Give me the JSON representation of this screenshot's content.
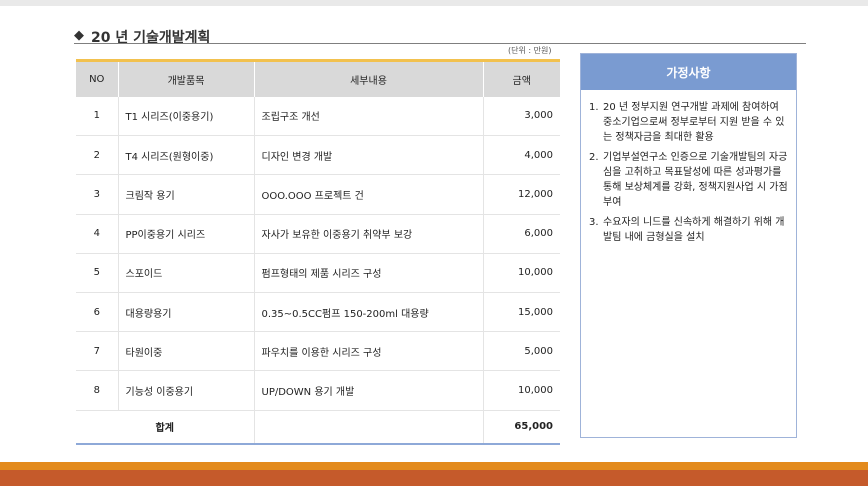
{
  "header": {
    "diamond": "◆",
    "title": "20   년 기술개발계획",
    "unit": "(단위 : 만원)"
  },
  "table": {
    "columns": [
      "NO",
      "개발품목",
      "세부내용",
      "금액"
    ],
    "rows": [
      {
        "no": "1",
        "item": "T1 시리즈(이중용기)",
        "detail": "조립구조 개선",
        "amount": "3,000"
      },
      {
        "no": "2",
        "item": "T4 시리즈(원형이중)",
        "detail": "디자인 변경 개발",
        "amount": "4,000"
      },
      {
        "no": "3",
        "item": "크림작 용기",
        "detail": "OOO.OOO 프로젝트 건",
        "amount": "12,000"
      },
      {
        "no": "4",
        "item": "PP이중용기 시리즈",
        "detail": "자사가 보유한 이중용기 취약부 보강",
        "amount": "6,000"
      },
      {
        "no": "5",
        "item": "스포이드",
        "detail": "펌프형태의 제품 시리즈 구성",
        "amount": "10,000"
      },
      {
        "no": "6",
        "item": "대용량용기",
        "detail": "0.35~0.5CC펌프 150-200ml 대용량",
        "amount": "15,000"
      },
      {
        "no": "7",
        "item": "타원이중",
        "detail": "파우치를 이용한 시리즈 구성",
        "amount": "5,000"
      },
      {
        "no": "8",
        "item": "기능성 이중용기",
        "detail": "UP/DOWN 용기 개발",
        "amount": "10,000"
      }
    ],
    "total_label": "합계",
    "total_amount": "65,000"
  },
  "assumptions": {
    "title": "가정사항",
    "items": [
      {
        "num": "1.",
        "text": "20   년 정부지원 연구개발 과제에 참여하여 중소기업으로써 정부로부터 지원 받을 수 있는 정책자금을 최대한 활용"
      },
      {
        "num": "2.",
        "text": "기업부설연구소 인증으로 기술개발팀의 자긍심을 고취하고 목표달성에 따른 성과평가를 통해 보상체계를 강화, 정책지원사업 시 가점 부여"
      },
      {
        "num": "3.",
        "text": "수요자의 니드를 신속하게 해결하기 위해 개발팀 내에 금형실을 설치"
      }
    ]
  },
  "colors": {
    "header_accent": "#f2c14e",
    "assumptions_header": "#7a9bd1",
    "footer_orange": "#e38a1d",
    "footer_rust": "#c55a2b"
  }
}
